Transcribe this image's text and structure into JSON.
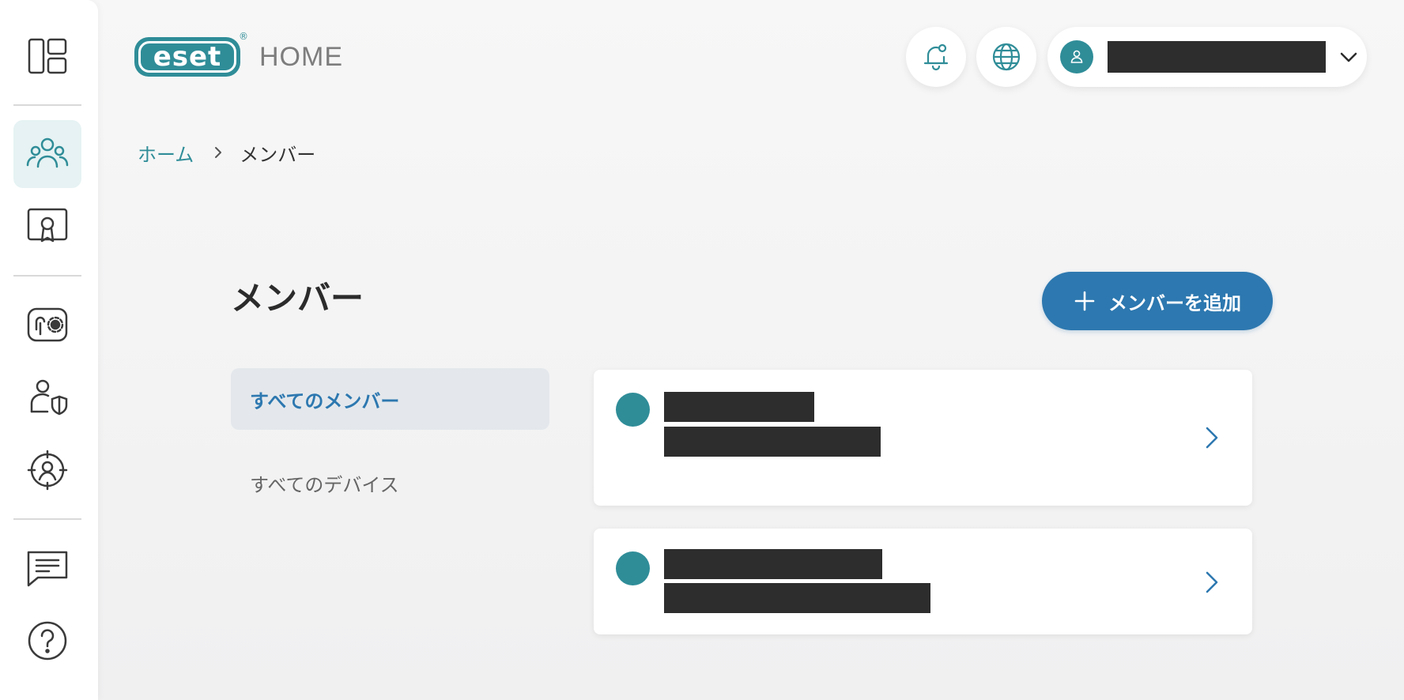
{
  "sidebar": {
    "items": [
      {
        "name": "dashboard-icon"
      },
      {
        "name": "members-icon",
        "active": true
      },
      {
        "name": "license-icon"
      },
      {
        "name": "anti-theft-icon"
      },
      {
        "name": "parental-control-icon"
      },
      {
        "name": "privacy-icon"
      },
      {
        "name": "feedback-icon"
      },
      {
        "name": "help-icon"
      }
    ]
  },
  "header": {
    "logo_text": "eset",
    "logo_reg": "®",
    "product": "HOME",
    "account_name": "",
    "notifications_icon": "bell-icon",
    "language_icon": "globe-icon"
  },
  "breadcrumb": {
    "home": "ホーム",
    "current": "メンバー"
  },
  "main": {
    "title": "メンバー",
    "add_button_label": "メンバーを追加",
    "filters": [
      {
        "label": "すべてのメンバー",
        "active": true
      },
      {
        "label": "すべてのデバイス",
        "active": false
      }
    ],
    "members": [
      {
        "name": "",
        "email": ""
      },
      {
        "name": "",
        "email": ""
      }
    ]
  },
  "colors": {
    "teal": "#2f8d98",
    "primary_blue": "#2d78b0",
    "redaction": "#2d2d2d"
  }
}
